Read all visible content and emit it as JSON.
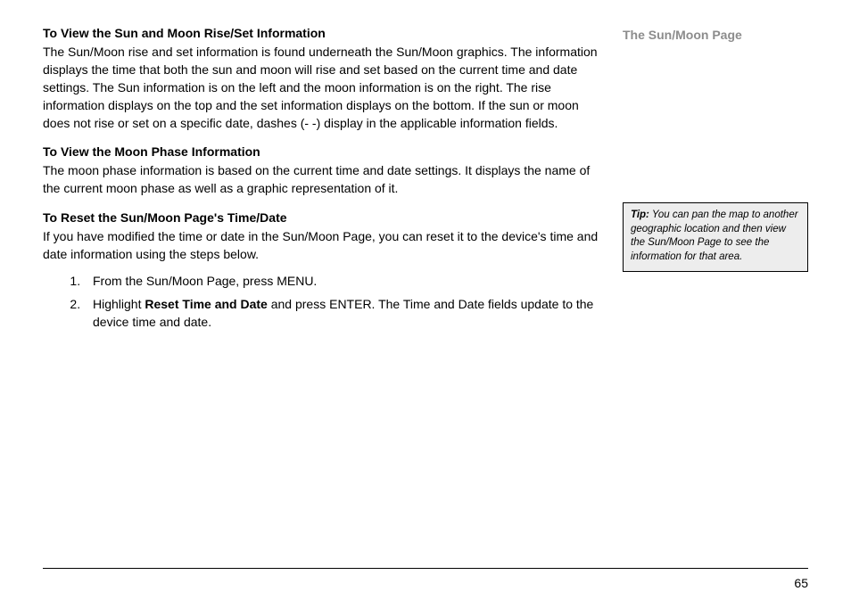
{
  "side": {
    "title": "The Sun/Moon Page",
    "tip_label": "Tip:",
    "tip_text": " You can pan the map to another geographic location and then view the Sun/Moon Page to see the information for that area."
  },
  "sections": {
    "s1": {
      "heading": "To View the Sun and Moon Rise/Set Information",
      "body": "The Sun/Moon rise and set information is found underneath the Sun/Moon graphics. The information displays the time that both the sun and moon will rise and set based on the current time and date settings. The Sun information is on the left and the moon information is on the right. The rise information displays on the top and the set information displays on the bottom. If the sun or moon does not rise or set on a specific date, dashes (- -) display in the applicable information fields."
    },
    "s2": {
      "heading": "To View the Moon Phase Information",
      "body": "The moon phase information is based on the current time and date settings. It displays the name of the current moon phase as well as a graphic representation of it."
    },
    "s3": {
      "heading": "To Reset the Sun/Moon Page's Time/Date",
      "body": "If you have modified the time or date in the Sun/Moon Page, you can reset it to the device's time and date information using the steps below.",
      "steps": {
        "step1": "From the Sun/Moon Page, press MENU.",
        "step2_a": "Highlight ",
        "step2_strong": "Reset Time and Date",
        "step2_b": " and press ENTER. The Time and Date fields update to the device time and date."
      }
    }
  },
  "page_number": "65"
}
